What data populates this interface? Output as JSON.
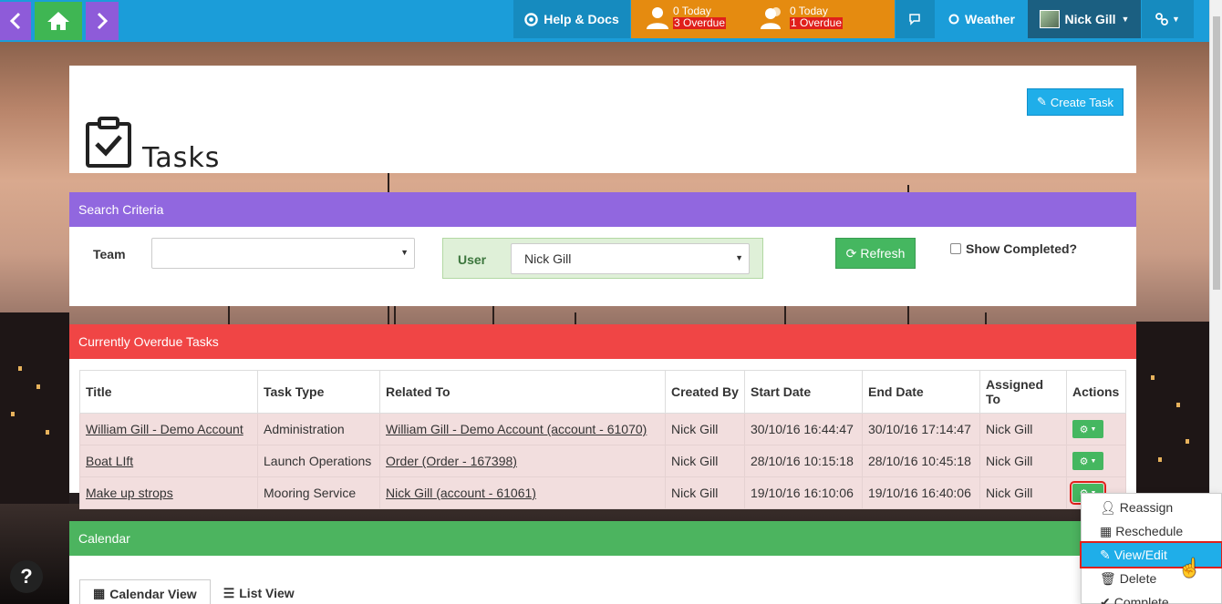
{
  "nav": {
    "help_label": "Help & Docs",
    "my_tasks": {
      "today": "0 Today",
      "overdue": "3 Overdue"
    },
    "team_tasks": {
      "today": "0 Today",
      "overdue": "1 Overdue"
    },
    "weather_label": "Weather",
    "user_name": "Nick Gill",
    "icons": {
      "back": "chevron-left-icon",
      "home": "home-icon",
      "forward": "chevron-right-icon",
      "help": "lifebuoy-icon",
      "chat": "chat-icon",
      "weather": "sun-icon",
      "links": "link-icon"
    }
  },
  "page": {
    "title": "Tasks",
    "create_label": "Create Task"
  },
  "search": {
    "heading": "Search Criteria",
    "team_label": "Team",
    "team_value": "",
    "user_label": "User",
    "user_value": "Nick Gill",
    "refresh_label": "Refresh",
    "show_completed_label": "Show Completed?"
  },
  "overdue": {
    "heading": "Currently Overdue Tasks",
    "columns": [
      "Title",
      "Task Type",
      "Related To",
      "Created By",
      "Start Date",
      "End Date",
      "Assigned To",
      "Actions"
    ],
    "rows": [
      {
        "title": "William Gill - Demo Account",
        "type": "Administration",
        "related": "William Gill - Demo Account (account - 61070)",
        "created_by": "Nick Gill",
        "start": "30/10/16 16:44:47",
        "end": "30/10/16 17:14:47",
        "assigned": "Nick Gill"
      },
      {
        "title": "Boat LIft",
        "type": "Launch Operations",
        "related": "Order (Order - 167398)",
        "created_by": "Nick Gill",
        "start": "28/10/16 10:15:18",
        "end": "28/10/16 10:45:18",
        "assigned": "Nick Gill"
      },
      {
        "title": "Make up strops",
        "type": "Mooring Service",
        "related": "Nick Gill (account - 61061)",
        "created_by": "Nick Gill",
        "start": "19/10/16 16:10:06",
        "end": "19/10/16 16:40:06",
        "assigned": "Nick Gill"
      }
    ]
  },
  "calendar": {
    "heading": "Calendar",
    "tab_calendar": "Calendar View",
    "tab_list": "List View"
  },
  "actions_menu": {
    "items": [
      "Reassign",
      "Reschedule",
      "View/Edit",
      "Delete",
      "Complete"
    ],
    "selected": "View/Edit"
  },
  "colors": {
    "topbar": "#1b9dd9",
    "purple": "#9167df",
    "red": "#f04545",
    "green": "#4cb45f",
    "orange": "#e58b10"
  }
}
